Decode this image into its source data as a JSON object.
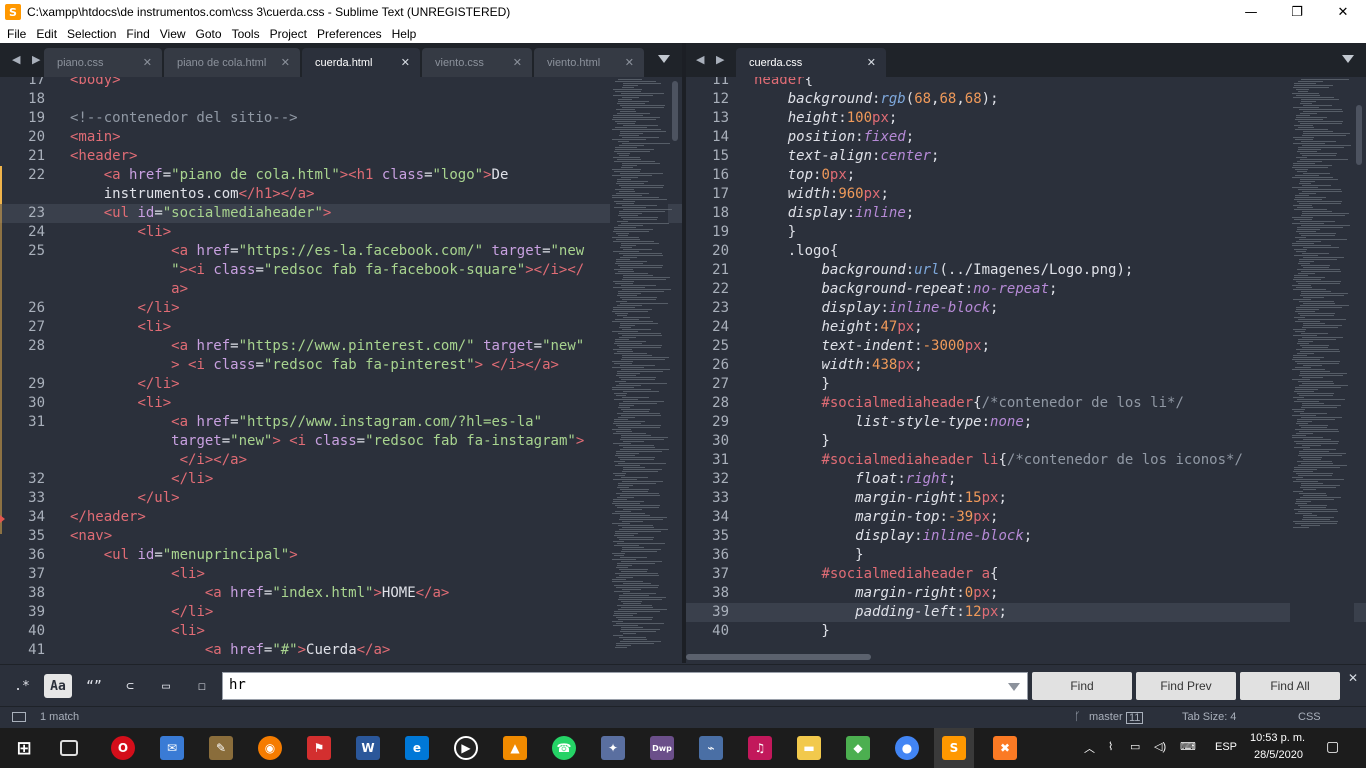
{
  "window": {
    "title": "C:\\xampp\\htdocs\\de instrumentos.com\\css 3\\cuerda.css - Sublime Text (UNREGISTERED)",
    "minimize": "—",
    "maximize": "❐",
    "close": "✕"
  },
  "menu": [
    "File",
    "Edit",
    "Selection",
    "Find",
    "View",
    "Goto",
    "Tools",
    "Project",
    "Preferences",
    "Help"
  ],
  "left_tabs": [
    {
      "label": "piano.css",
      "active": false
    },
    {
      "label": "piano de cola.html",
      "active": false
    },
    {
      "label": "cuerda.html",
      "active": true
    },
    {
      "label": "viento.css",
      "active": false
    },
    {
      "label": "viento.html",
      "active": false
    }
  ],
  "right_tabs": [
    {
      "label": "cuerda.css",
      "active": true
    }
  ],
  "tab_close_glyph": "✕",
  "tab_arrows": "◀ ▶",
  "left_editor": {
    "lines": [
      {
        "n": "17",
        "html": "<span class=\"t\">&lt;body&gt;</span>"
      },
      {
        "n": "18",
        "html": ""
      },
      {
        "n": "19",
        "html": "<span class=\"c\">&lt;!--contenedor del sitio--&gt;</span>"
      },
      {
        "n": "20",
        "html": "<span class=\"t\">&lt;main&gt;</span>"
      },
      {
        "n": "21",
        "html": "<span class=\"t\">&lt;header&gt;</span>"
      },
      {
        "n": "22",
        "html": "    <span class=\"t\">&lt;a</span> <span class=\"a\">href</span>=<span class=\"s\">\"piano de cola.html\"</span><span class=\"t\">&gt;&lt;h1</span> <span class=\"a\">class</span>=<span class=\"s\">\"logo\"</span><span class=\"t\">&gt;</span>De"
      },
      {
        "n": "",
        "html": "    instrumentos.com<span class=\"t\">&lt;/h1&gt;&lt;/a&gt;</span>"
      },
      {
        "n": "23",
        "html": "    <span class=\"t\">&lt;ul</span> <span class=\"a\">id</span>=<span class=\"s\">\"socialmediaheader\"</span><span class=\"t\">&gt;</span>",
        "hl": true
      },
      {
        "n": "24",
        "html": "        <span class=\"t\">&lt;li&gt;</span>"
      },
      {
        "n": "25",
        "html": "            <span class=\"t\">&lt;a</span> <span class=\"a\">href</span>=<span class=\"s\">\"https://es-la.facebook.com/\"</span> <span class=\"a\">target</span>=<span class=\"s\">\"new</span>"
      },
      {
        "n": "",
        "html": "            <span class=\"s\">\"</span><span class=\"t\">&gt;&lt;i</span> <span class=\"a\">class</span>=<span class=\"s\">\"redsoc fab fa-facebook-square\"</span><span class=\"t\">&gt;&lt;/i&gt;&lt;/</span>"
      },
      {
        "n": "",
        "html": "            <span class=\"t\">a&gt;</span>"
      },
      {
        "n": "26",
        "html": "        <span class=\"t\">&lt;/li&gt;</span>"
      },
      {
        "n": "27",
        "html": "        <span class=\"t\">&lt;li&gt;</span>"
      },
      {
        "n": "28",
        "html": "            <span class=\"t\">&lt;a</span> <span class=\"a\">href</span>=<span class=\"s\">\"https://www.pinterest.com/\"</span> <span class=\"a\">target</span>=<span class=\"s\">\"new\"</span>"
      },
      {
        "n": "",
        "html": "            <span class=\"t\">&gt;</span> <span class=\"t\">&lt;i</span> <span class=\"a\">class</span>=<span class=\"s\">\"redsoc fab fa-pinterest\"</span><span class=\"t\">&gt;</span> <span class=\"t\">&lt;/i&gt;&lt;/a&gt;</span>"
      },
      {
        "n": "29",
        "html": "        <span class=\"t\">&lt;/li&gt;</span>"
      },
      {
        "n": "30",
        "html": "        <span class=\"t\">&lt;li&gt;</span>"
      },
      {
        "n": "31",
        "html": "            <span class=\"t\">&lt;a</span> <span class=\"a\">href</span>=<span class=\"s\">\"https//www.instagram.com/?hl=es-la\"</span>"
      },
      {
        "n": "",
        "html": "            <span class=\"a\">target</span>=<span class=\"s\">\"new\"</span><span class=\"t\">&gt;</span> <span class=\"t\">&lt;i</span> <span class=\"a\">class</span>=<span class=\"s\">\"redsoc fab fa-instagram\"</span><span class=\"t\">&gt;</span>"
      },
      {
        "n": "",
        "html": "             <span class=\"t\">&lt;/i&gt;&lt;/a&gt;</span>"
      },
      {
        "n": "32",
        "html": "            <span class=\"t\">&lt;/li&gt;</span>"
      },
      {
        "n": "33",
        "html": "        <span class=\"t\">&lt;/ul&gt;</span>"
      },
      {
        "n": "34",
        "html": "<span class=\"t\">&lt;/header&gt;</span>"
      },
      {
        "n": "35",
        "html": "<span class=\"t\">&lt;nav&gt;</span>"
      },
      {
        "n": "36",
        "html": "    <span class=\"t\">&lt;ul</span> <span class=\"a\">id</span>=<span class=\"s\">\"menuprincipal\"</span><span class=\"t\">&gt;</span>"
      },
      {
        "n": "37",
        "html": "            <span class=\"t\">&lt;li&gt;</span>"
      },
      {
        "n": "38",
        "html": "                <span class=\"t\">&lt;a</span> <span class=\"a\">href</span>=<span class=\"s\">\"index.html\"</span><span class=\"t\">&gt;</span>HOME<span class=\"t\">&lt;/a&gt;</span>"
      },
      {
        "n": "39",
        "html": "            <span class=\"t\">&lt;/li&gt;</span>"
      },
      {
        "n": "40",
        "html": "            <span class=\"t\">&lt;li&gt;</span>"
      },
      {
        "n": "41",
        "html": "                <span class=\"t\">&lt;a</span> <span class=\"a\">href</span>=<span class=\"s\">\"#\"</span><span class=\"t\">&gt;</span>Cuerda<span class=\"t\">&lt;/a&gt;</span>"
      }
    ]
  },
  "right_editor": {
    "lines": [
      {
        "n": "11",
        "html": "<span class=\"sel\">header</span>{"
      },
      {
        "n": "12",
        "html": "    <span class=\"prop\">background</span>:<span class=\"fn\">rgb</span>(<span class=\"num\">68</span>,<span class=\"num\">68</span>,<span class=\"num\">68</span>);"
      },
      {
        "n": "13",
        "html": "    <span class=\"prop\">height</span>:<span class=\"num\">100</span><span class=\"t\">px</span>;"
      },
      {
        "n": "14",
        "html": "    <span class=\"prop\">position</span>:<span class=\"kw\">fixed</span>;"
      },
      {
        "n": "15",
        "html": "    <span class=\"prop\">text-align</span>:<span class=\"kw\">center</span>;"
      },
      {
        "n": "16",
        "html": "    <span class=\"prop\">top</span>:<span class=\"num\">0</span><span class=\"t\">px</span>;"
      },
      {
        "n": "17",
        "html": "    <span class=\"prop\">width</span>:<span class=\"num\">960</span><span class=\"t\">px</span>;"
      },
      {
        "n": "18",
        "html": "    <span class=\"prop\">display</span>:<span class=\"kw\">inline</span>;"
      },
      {
        "n": "19",
        "html": "    }"
      },
      {
        "n": "20",
        "html": "    <span class=\"p\">.logo</span>{"
      },
      {
        "n": "21",
        "html": "        <span class=\"prop\">background</span>:<span class=\"fn\">url</span>(../Imagenes/Logo.png);"
      },
      {
        "n": "22",
        "html": "        <span class=\"prop\">background-repeat</span>:<span class=\"kw\">no-repeat</span>;"
      },
      {
        "n": "23",
        "html": "        <span class=\"prop\">display</span>:<span class=\"kw\">inline-block</span>;"
      },
      {
        "n": "24",
        "html": "        <span class=\"prop\">height</span>:<span class=\"num\">47</span><span class=\"t\">px</span>;"
      },
      {
        "n": "25",
        "html": "        <span class=\"prop\">text-indent</span>:<span class=\"num\">-3000</span><span class=\"t\">px</span>;"
      },
      {
        "n": "26",
        "html": "        <span class=\"prop\">width</span>:<span class=\"num\">438</span><span class=\"t\">px</span>;"
      },
      {
        "n": "27",
        "html": "        }"
      },
      {
        "n": "28",
        "html": "        <span class=\"sel\">#socialmediaheader</span>{<span class=\"c\">/*contenedor de los li*/</span>"
      },
      {
        "n": "29",
        "html": "            <span class=\"prop\">list-style-type</span>:<span class=\"kw\">none</span>;"
      },
      {
        "n": "30",
        "html": "        }"
      },
      {
        "n": "31",
        "html": "        <span class=\"sel\">#socialmediaheader li</span>{<span class=\"c\">/*contenedor de los iconos*/</span>"
      },
      {
        "n": "32",
        "html": "            <span class=\"prop\">float</span>:<span class=\"kw\">right</span>;"
      },
      {
        "n": "33",
        "html": "            <span class=\"prop\">margin-right</span>:<span class=\"num\">15</span><span class=\"t\">px</span>;"
      },
      {
        "n": "34",
        "html": "            <span class=\"prop\">margin-top</span>:<span class=\"num\">-39</span><span class=\"t\">px</span>;"
      },
      {
        "n": "35",
        "html": "            <span class=\"prop\">display</span>:<span class=\"kw\">inline-block</span>;"
      },
      {
        "n": "36",
        "html": "            }"
      },
      {
        "n": "37",
        "html": "        <span class=\"sel\">#socialmediaheader a</span>{"
      },
      {
        "n": "38",
        "html": "            <span class=\"prop\">margin-right</span>:<span class=\"num\">0</span><span class=\"t\">px</span>;"
      },
      {
        "n": "39",
        "html": "            <span class=\"prop\">padding-left</span>:<span class=\"num\">12</span><span class=\"t\">px</span>;",
        "hl": true
      },
      {
        "n": "40",
        "html": "        }"
      }
    ]
  },
  "find": {
    "options": [
      ".*",
      "Aa",
      "“”",
      "⊂",
      "▭",
      "☐"
    ],
    "value": "hr",
    "buttons": [
      "Find",
      "Find Prev",
      "Find All"
    ],
    "close": "✕"
  },
  "status": {
    "matches": "1 match",
    "branch": "master",
    "branch_count": "11",
    "tab_size": "Tab Size: 4",
    "syntax": "CSS"
  },
  "taskbar": {
    "language": "ESP",
    "time": "10:53 p. m.",
    "date": "28/5/2020"
  },
  "colors": {
    "editor_bg": "#2b303b",
    "tag": "#e06c75",
    "attr": "#c8a0e0",
    "string": "#a8d48f",
    "number": "#f09a5a"
  }
}
